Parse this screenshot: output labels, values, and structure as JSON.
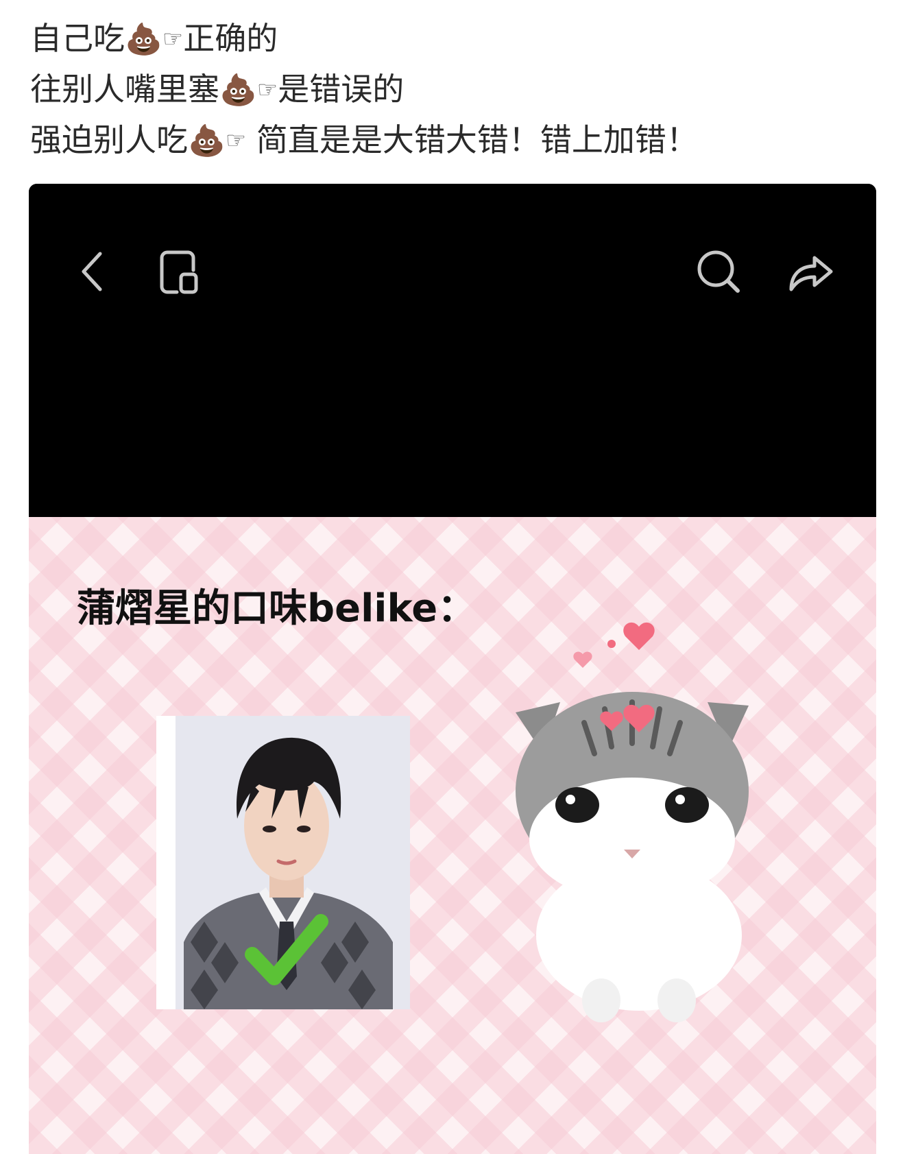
{
  "post": {
    "lines": [
      {
        "before": "自己吃",
        "emoji": "💩",
        "hand": "☞",
        "after": "正确的"
      },
      {
        "before": "往别人嘴里塞",
        "emoji": "💩",
        "hand": "☞",
        "after": "是错误的"
      },
      {
        "before": "强迫别人吃",
        "emoji": "💩",
        "hand": "☞",
        "after": " 简直是是大错大错！错上加错！"
      }
    ]
  },
  "viewer": {
    "icons": [
      "chevron-left-icon",
      "picture-in-picture-icon",
      "search-icon",
      "share-icon"
    ]
  },
  "meme": {
    "title": "蒲熠星的口味belike："
  },
  "colors": {
    "text": "#2a2a2a",
    "viewer_bg": "#000000",
    "pattern_pink": "#f7cdd6",
    "check_green": "#5bc236",
    "heart_pink": "#f26b80"
  }
}
